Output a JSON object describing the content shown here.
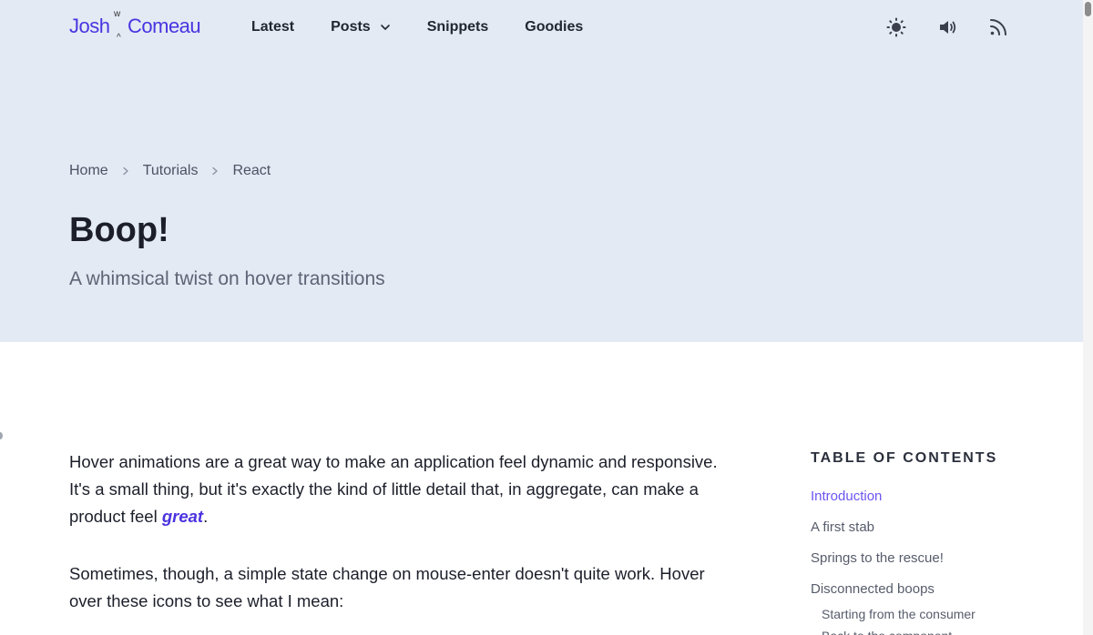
{
  "logo": {
    "first": "Josh",
    "last": "Comeau",
    "deco_top": "w",
    "deco_bottom": "^"
  },
  "nav": {
    "items": [
      {
        "label": "Latest"
      },
      {
        "label": "Posts"
      },
      {
        "label": "Snippets"
      },
      {
        "label": "Goodies"
      }
    ],
    "icons": [
      "sun-icon",
      "volume-icon",
      "rss-icon"
    ]
  },
  "breadcrumb": [
    "Home",
    "Tutorials",
    "React"
  ],
  "hero": {
    "title": "Boop!",
    "subtitle": "A whimsical twist on hover transitions"
  },
  "article": {
    "p1_before": "Hover animations are a great way to make an application feel dynamic and responsive. It's a small thing, but it's exactly the kind of little detail that, in aggregate, can make a product feel ",
    "p1_link": "great",
    "p1_after": ".",
    "p2": "Sometimes, though, a simple state change on mouse-enter doesn't quite work. Hover over these icons to see what I mean:"
  },
  "toc": {
    "heading": "TABLE OF CONTENTS",
    "items": [
      {
        "label": "Introduction"
      },
      {
        "label": "A first stab"
      },
      {
        "label": "Springs to the rescue!"
      },
      {
        "label": "Disconnected boops"
      }
    ],
    "subitems": [
      {
        "label": "Starting from the consumer"
      },
      {
        "label": "Back to the component"
      }
    ]
  },
  "colors": {
    "brand": "#4a33e0",
    "hero_bg": "#e3eaf4",
    "toc_active": "#6b55f0"
  }
}
